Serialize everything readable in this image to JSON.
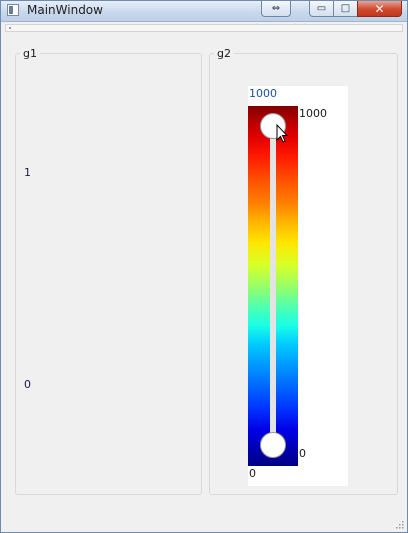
{
  "window": {
    "title": "MainWindow"
  },
  "titlebar_buttons": {
    "extra": "⇔",
    "minimize": "▭",
    "maximize": "□",
    "close": "✕"
  },
  "groups": {
    "g1": {
      "title": "g1",
      "labels": {
        "top": "1",
        "bottom": "0"
      }
    },
    "g2": {
      "title": "g2",
      "range_slider": {
        "upper_value_display": "1000",
        "max_label": "1000",
        "min_label": "0",
        "lower_value_display": "0",
        "upper_value": 1000,
        "lower_value": 0,
        "colormap": "jet"
      }
    }
  },
  "colors": {
    "accent_blue": "#1b4fa0",
    "close_red": "#cf4a30",
    "window_bg": "#f0f0f0"
  }
}
